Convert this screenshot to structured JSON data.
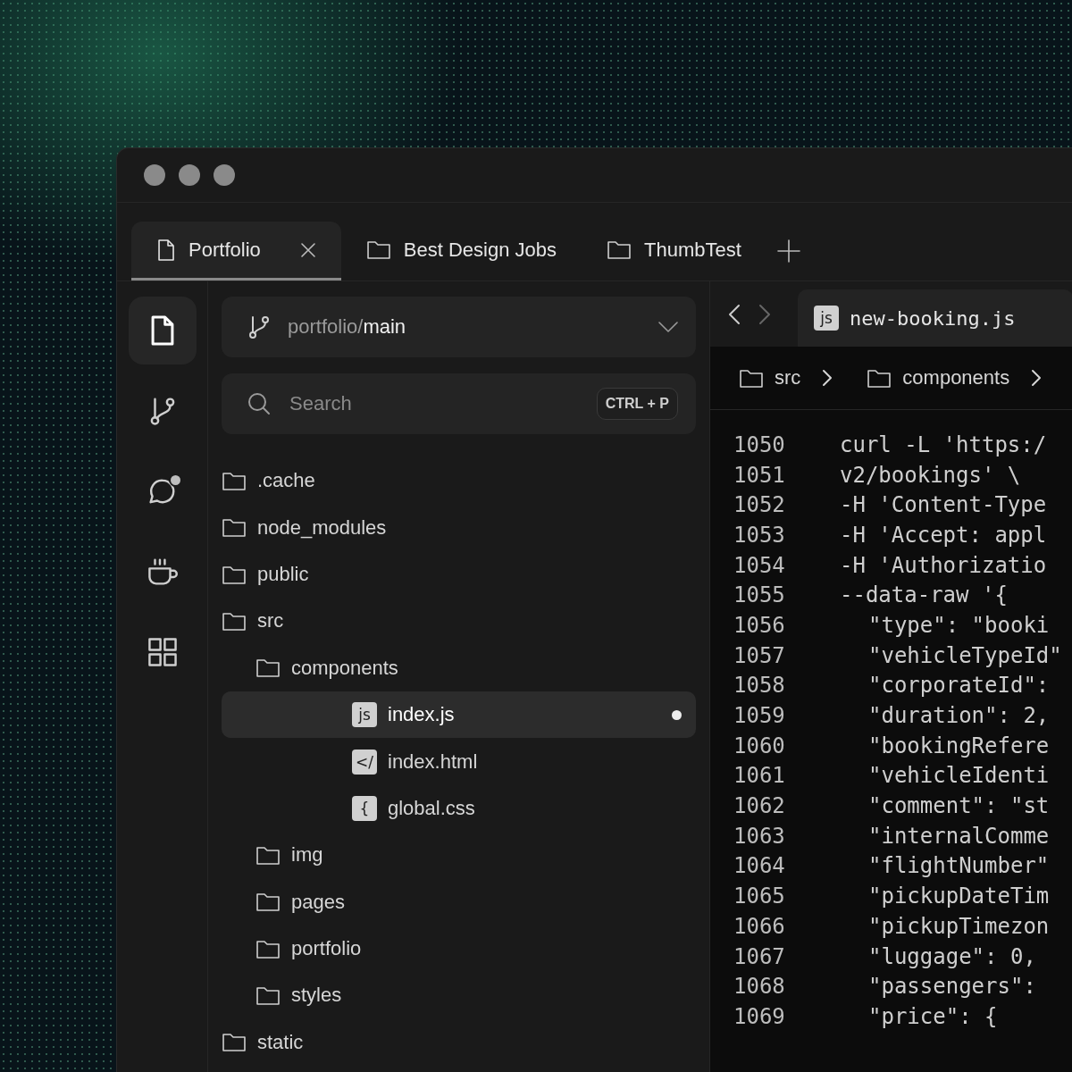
{
  "tabs": [
    {
      "label": "Portfolio",
      "kind": "file",
      "selected": true
    },
    {
      "label": "Best Design Jobs",
      "kind": "folder",
      "selected": false
    },
    {
      "label": "ThumbTest",
      "kind": "folder",
      "selected": false
    }
  ],
  "activity_bar": [
    {
      "kind": "files",
      "selected": true,
      "notification": false
    },
    {
      "kind": "branch",
      "selected": false,
      "notification": false
    },
    {
      "kind": "chat",
      "selected": false,
      "notification": true
    },
    {
      "kind": "cup",
      "selected": false,
      "notification": false
    },
    {
      "kind": "grid",
      "selected": false,
      "notification": false
    }
  ],
  "branch": {
    "repo": "portfolio/",
    "name": "main"
  },
  "search": {
    "placeholder": "Search",
    "shortcut": "CTRL + P"
  },
  "tree": [
    {
      "label": ".cache",
      "kind": "folder",
      "selected": false
    },
    {
      "label": "node_modules",
      "kind": "folder",
      "selected": false
    },
    {
      "label": "public",
      "kind": "folder",
      "selected": false
    },
    {
      "label": "src",
      "kind": "folder",
      "selected": false,
      "children": [
        {
          "label": "components",
          "kind": "folder",
          "selected": false,
          "children": [
            {
              "label": "index.js",
              "kind": "file",
              "badge": "js",
              "selected": true,
              "modified": true
            },
            {
              "label": "index.html",
              "kind": "file",
              "badge": "</",
              "selected": false,
              "modified": false
            },
            {
              "label": "global.css",
              "kind": "file",
              "badge": "{",
              "selected": false,
              "modified": false
            }
          ]
        },
        {
          "label": "img",
          "kind": "folder",
          "selected": false
        },
        {
          "label": "pages",
          "kind": "folder",
          "selected": false
        },
        {
          "label": "portfolio",
          "kind": "folder",
          "selected": false
        },
        {
          "label": "styles",
          "kind": "folder",
          "selected": false
        }
      ]
    },
    {
      "label": "static",
      "kind": "folder",
      "selected": false
    }
  ],
  "editor": {
    "file_tab": {
      "badge": "js",
      "label": "new-booking.js"
    },
    "breadcrumb": [
      "src",
      "components"
    ],
    "lines": [
      {
        "number": "1050",
        "kind": "command",
        "text": "curl -L 'https:/"
      },
      {
        "number": "1051",
        "kind": "command",
        "text": "v2/bookings' \\"
      },
      {
        "number": "1052",
        "kind": "command",
        "text": "-H 'Content-Type"
      },
      {
        "number": "1053",
        "kind": "command",
        "text": "-H 'Accept: appl"
      },
      {
        "number": "1054",
        "kind": "command",
        "text": "-H 'Authorizatio"
      },
      {
        "number": "1055",
        "kind": "command",
        "text": "--data-raw '{"
      },
      {
        "number": "1056",
        "kind": "body",
        "text": "\"type\": \"booki"
      },
      {
        "number": "1057",
        "kind": "body",
        "text": "\"vehicleTypeId\""
      },
      {
        "number": "1058",
        "kind": "body",
        "text": "\"corporateId\":"
      },
      {
        "number": "1059",
        "kind": "body",
        "text": "\"duration\": 2,"
      },
      {
        "number": "1060",
        "kind": "body",
        "text": "\"bookingRefere"
      },
      {
        "number": "1061",
        "kind": "body",
        "text": "\"vehicleIdenti"
      },
      {
        "number": "1062",
        "kind": "body",
        "text": "\"comment\": \"st"
      },
      {
        "number": "1063",
        "kind": "body",
        "text": "\"internalComme"
      },
      {
        "number": "1064",
        "kind": "body",
        "text": "\"flightNumber\""
      },
      {
        "number": "1065",
        "kind": "body",
        "text": "\"pickupDateTim"
      },
      {
        "number": "1066",
        "kind": "body",
        "text": "\"pickupTimezon"
      },
      {
        "number": "1067",
        "kind": "body",
        "text": "\"luggage\": 0,"
      },
      {
        "number": "1068",
        "kind": "body",
        "text": "\"passengers\":"
      },
      {
        "number": "1069",
        "kind": "body",
        "text": "\"price\": {"
      }
    ]
  }
}
